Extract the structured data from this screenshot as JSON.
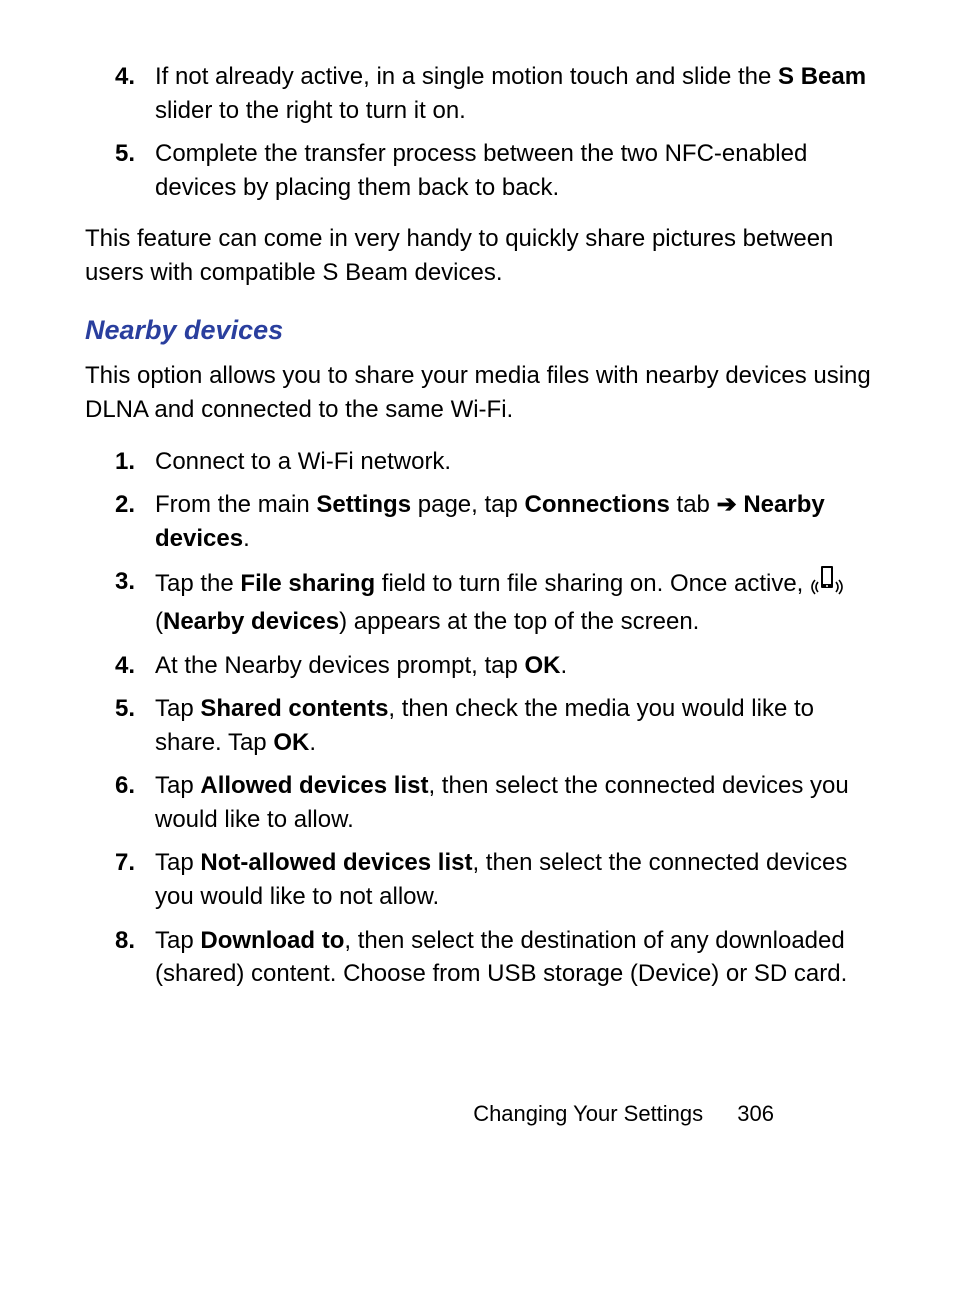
{
  "list1": {
    "item4": {
      "num": "4.",
      "t1": "If not already active, in a single motion touch and slide the ",
      "b1": "S Beam",
      "t2": " slider to the right to turn it on."
    },
    "item5": {
      "num": "5.",
      "t1": "Complete the transfer process between the two NFC-enabled devices by placing them back to back."
    }
  },
  "para1": "This feature can come in very handy to quickly share pictures between users with compatible S Beam devices.",
  "heading": "Nearby devices",
  "para2": "This option allows you to share your media files with nearby devices using DLNA and connected to the same Wi-Fi.",
  "list2": {
    "item1": {
      "num": "1.",
      "t1": "Connect to a Wi-Fi network."
    },
    "item2": {
      "num": "2.",
      "t1": "From the main ",
      "b1": "Settings",
      "t2": " page, tap ",
      "b2": "Connections",
      "t3": " tab ",
      "arrow": "➔",
      "t4": " ",
      "b3": "Nearby devices",
      "t5": "."
    },
    "item3": {
      "num": "3.",
      "t1": "Tap the ",
      "b1": "File sharing",
      "t2": " field to turn file sharing on. Once active, ",
      "t3": " (",
      "b2": "Nearby devices",
      "t4": ") appears at the top of the screen."
    },
    "item4": {
      "num": "4.",
      "t1": "At the Nearby devices prompt, tap ",
      "b1": "OK",
      "t2": "."
    },
    "item5": {
      "num": "5.",
      "t1": "Tap ",
      "b1": "Shared contents",
      "t2": ", then check the media you would like to share. Tap ",
      "b2": "OK",
      "t3": "."
    },
    "item6": {
      "num": "6.",
      "t1": "Tap ",
      "b1": "Allowed devices list",
      "t2": ", then select the connected devices you would like to allow."
    },
    "item7": {
      "num": "7.",
      "t1": "Tap ",
      "b1": "Not-allowed devices list",
      "t2": ", then select the connected devices you would like to not allow."
    },
    "item8": {
      "num": "8.",
      "t1": "Tap ",
      "b1": "Download to",
      "t2": ", then select the destination of any downloaded (shared) content. Choose from USB storage (Device) or SD card."
    }
  },
  "footer": {
    "section": "Changing Your Settings",
    "page": "306"
  }
}
